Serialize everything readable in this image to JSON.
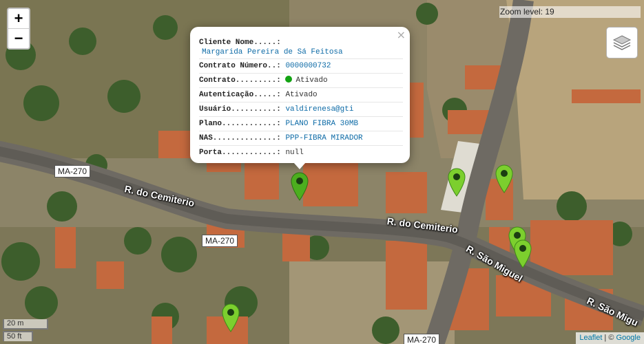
{
  "map": {
    "zoom_in_label": "+",
    "zoom_out_label": "−",
    "zoom_level_text": "Zoom level: 19",
    "layers_icon": "layers-icon",
    "roads": {
      "cemiterio_1": "R. do Cemiterio",
      "cemiterio_2": "R. do Cemiterio",
      "sao_miguel_1": "R. São Miguel",
      "sao_miguel_2": "R. São Migu",
      "ma270_a": "MA-270",
      "ma270_b": "MA-270",
      "ma270_c": "MA-270"
    },
    "scale": {
      "metric": "20 m",
      "imperial": "50 ft"
    },
    "attribution": {
      "leaflet": "Leaflet",
      "separator": " | © ",
      "google": "Google"
    },
    "marker_colors": {
      "default": "#7ccf2e",
      "selected": "#4cae1f",
      "dot": "#1b3d12"
    }
  },
  "popup": {
    "close_label": "×",
    "rows": [
      {
        "label": "Cliente Nome.....:",
        "value": "Margarida Pereira de Sá Feitosa"
      },
      {
        "label": "Contrato Número..:",
        "value": "0000000732"
      },
      {
        "label": "Contrato.........:",
        "value": "Ativado",
        "status_color": "#13a313"
      },
      {
        "label": "Autenticação.....:",
        "value": "Ativado"
      },
      {
        "label": "Usuário..........:",
        "value": "valdirenesa@gti"
      },
      {
        "label": "Plano............:",
        "value": "PLANO FIBRA 30MB"
      },
      {
        "label": "NAS..............:",
        "value": "PPP-FIBRA MIRADOR"
      },
      {
        "label": "Porta............:",
        "value": "null"
      }
    ]
  }
}
